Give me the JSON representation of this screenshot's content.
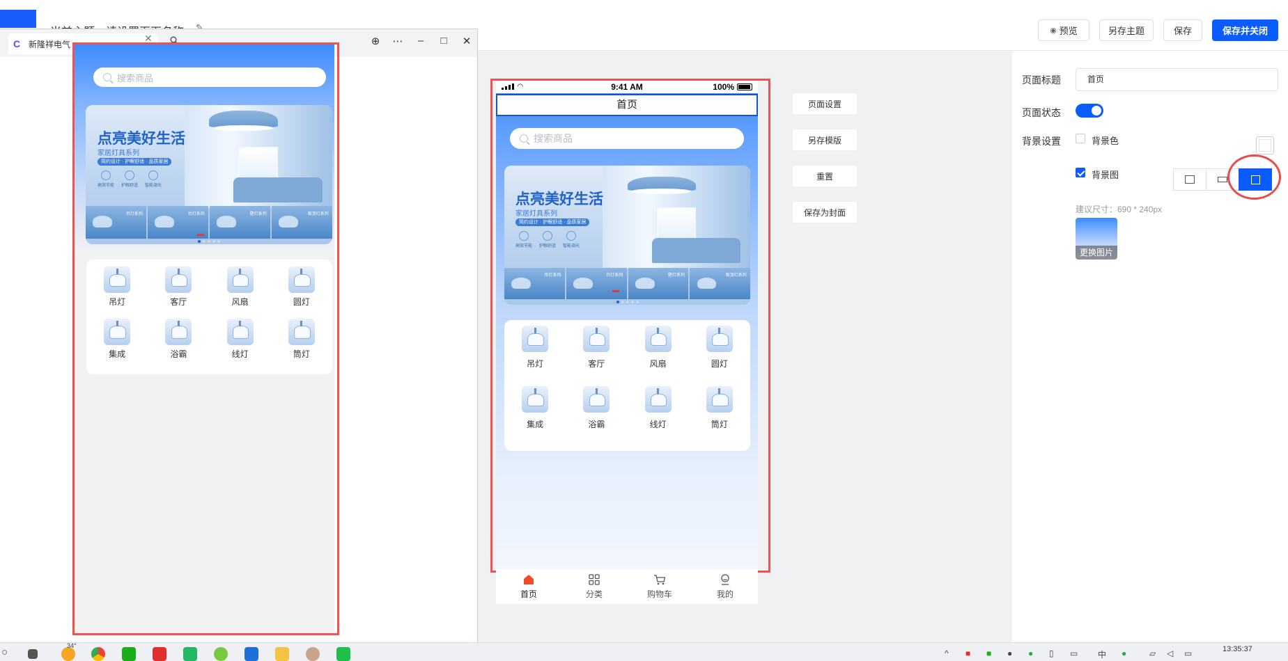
{
  "editor": {
    "page_name": "当前主题：请设置页面名称",
    "toolbar": {
      "preview": "预览",
      "save_as_theme": "另存主题",
      "save": "保存",
      "save_close": "保存并关闭"
    },
    "side_buttons": [
      "页面设置",
      "另存模版",
      "重置",
      "保存为封面"
    ]
  },
  "phone": {
    "status": {
      "time": "9:41 AM",
      "battery": "100%"
    },
    "title": "首页",
    "search_placeholder": "搜索商品",
    "banner": {
      "title": "点亮美好生活",
      "subtitle": "家居灯具系列",
      "tags": "简约设计 · 护眼舒适 · 品质家居",
      "features": [
        "高效节能",
        "护眼舒适",
        "智能调光"
      ]
    },
    "categories": [
      "吊灯",
      "客厅",
      "风扇",
      "圆灯",
      "集成",
      "浴霸",
      "线灯",
      "筒灯"
    ],
    "tabbar": [
      "首页",
      "分类",
      "购物车",
      "我的"
    ]
  },
  "props": {
    "page_title_label": "页面标题",
    "page_title_value": "首页",
    "page_status_label": "页面状态",
    "page_status_on": true,
    "bg_label": "背景设置",
    "bg_color_label": "背景色",
    "bg_color_checked": false,
    "bg_image_label": "背景图",
    "bg_image_checked": true,
    "size_hint": "建议尺寸：690 * 240px",
    "replace_image": "更换图片",
    "fill_mode_selected": "stretch"
  },
  "browser": {
    "tab_title": "新隆祥电气",
    "search_placeholder": "搜索商品"
  },
  "taskbar": {
    "clock": "13:35:37",
    "weather": "34°",
    "ime": "中"
  },
  "colors": {
    "primary": "#0b5cff",
    "annotation_red": "#ec5454"
  }
}
